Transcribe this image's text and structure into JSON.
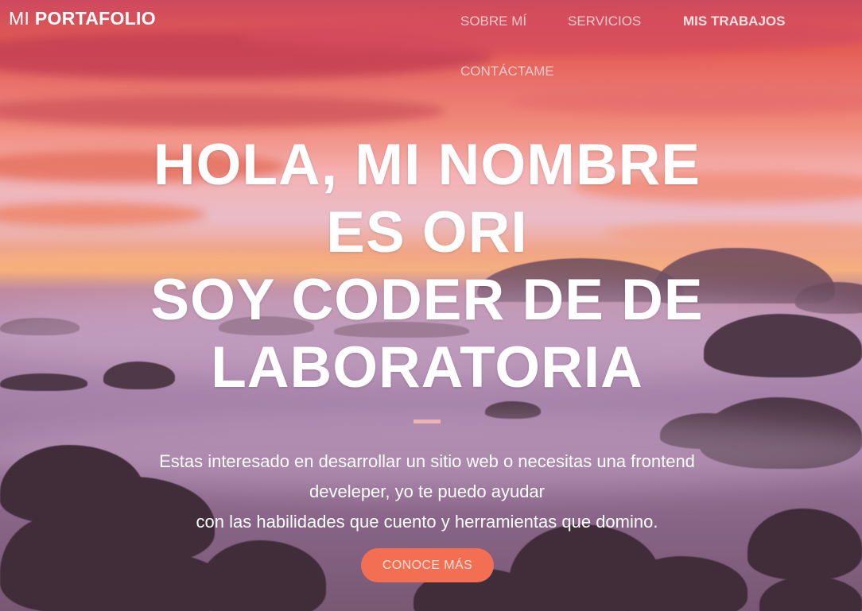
{
  "navbar": {
    "brand_prefix": "MI",
    "brand_name": "PORTAFOLIO",
    "links": [
      {
        "label": "SOBRE MÍ",
        "active": false
      },
      {
        "label": "SERVICIOS",
        "active": false
      },
      {
        "label": "MIS TRABAJOS",
        "active": true
      },
      {
        "label": "CONTÁCTAME",
        "active": false
      }
    ]
  },
  "hero": {
    "title_lines": [
      "HOLA, MI NOMBRE",
      "ES ORI",
      "SOY CODER DE DE",
      "LABORATORIA"
    ],
    "lead_lines": [
      "Estas interesado en desarrollar un sitio web o necesitas una frontend",
      "develeper, yo te puedo ayudar",
      "con las habilidades que cuento y herramientas que domino."
    ],
    "cta_label": "CONOCE MÁS"
  },
  "colors": {
    "accent": "#f26f53",
    "nav_text": "#f6c9c9",
    "hero_text": "#ffffff"
  }
}
